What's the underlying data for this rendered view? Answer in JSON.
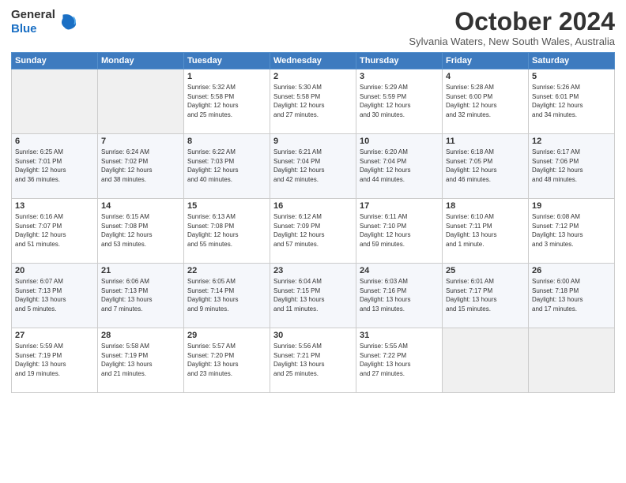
{
  "logo": {
    "general": "General",
    "blue": "Blue"
  },
  "header": {
    "month": "October 2024",
    "location": "Sylvania Waters, New South Wales, Australia"
  },
  "days_of_week": [
    "Sunday",
    "Monday",
    "Tuesday",
    "Wednesday",
    "Thursday",
    "Friday",
    "Saturday"
  ],
  "weeks": [
    [
      {
        "day": "",
        "info": ""
      },
      {
        "day": "",
        "info": ""
      },
      {
        "day": "1",
        "info": "Sunrise: 5:32 AM\nSunset: 5:58 PM\nDaylight: 12 hours\nand 25 minutes."
      },
      {
        "day": "2",
        "info": "Sunrise: 5:30 AM\nSunset: 5:58 PM\nDaylight: 12 hours\nand 27 minutes."
      },
      {
        "day": "3",
        "info": "Sunrise: 5:29 AM\nSunset: 5:59 PM\nDaylight: 12 hours\nand 30 minutes."
      },
      {
        "day": "4",
        "info": "Sunrise: 5:28 AM\nSunset: 6:00 PM\nDaylight: 12 hours\nand 32 minutes."
      },
      {
        "day": "5",
        "info": "Sunrise: 5:26 AM\nSunset: 6:01 PM\nDaylight: 12 hours\nand 34 minutes."
      }
    ],
    [
      {
        "day": "6",
        "info": "Sunrise: 6:25 AM\nSunset: 7:01 PM\nDaylight: 12 hours\nand 36 minutes."
      },
      {
        "day": "7",
        "info": "Sunrise: 6:24 AM\nSunset: 7:02 PM\nDaylight: 12 hours\nand 38 minutes."
      },
      {
        "day": "8",
        "info": "Sunrise: 6:22 AM\nSunset: 7:03 PM\nDaylight: 12 hours\nand 40 minutes."
      },
      {
        "day": "9",
        "info": "Sunrise: 6:21 AM\nSunset: 7:04 PM\nDaylight: 12 hours\nand 42 minutes."
      },
      {
        "day": "10",
        "info": "Sunrise: 6:20 AM\nSunset: 7:04 PM\nDaylight: 12 hours\nand 44 minutes."
      },
      {
        "day": "11",
        "info": "Sunrise: 6:18 AM\nSunset: 7:05 PM\nDaylight: 12 hours\nand 46 minutes."
      },
      {
        "day": "12",
        "info": "Sunrise: 6:17 AM\nSunset: 7:06 PM\nDaylight: 12 hours\nand 48 minutes."
      }
    ],
    [
      {
        "day": "13",
        "info": "Sunrise: 6:16 AM\nSunset: 7:07 PM\nDaylight: 12 hours\nand 51 minutes."
      },
      {
        "day": "14",
        "info": "Sunrise: 6:15 AM\nSunset: 7:08 PM\nDaylight: 12 hours\nand 53 minutes."
      },
      {
        "day": "15",
        "info": "Sunrise: 6:13 AM\nSunset: 7:08 PM\nDaylight: 12 hours\nand 55 minutes."
      },
      {
        "day": "16",
        "info": "Sunrise: 6:12 AM\nSunset: 7:09 PM\nDaylight: 12 hours\nand 57 minutes."
      },
      {
        "day": "17",
        "info": "Sunrise: 6:11 AM\nSunset: 7:10 PM\nDaylight: 12 hours\nand 59 minutes."
      },
      {
        "day": "18",
        "info": "Sunrise: 6:10 AM\nSunset: 7:11 PM\nDaylight: 13 hours\nand 1 minute."
      },
      {
        "day": "19",
        "info": "Sunrise: 6:08 AM\nSunset: 7:12 PM\nDaylight: 13 hours\nand 3 minutes."
      }
    ],
    [
      {
        "day": "20",
        "info": "Sunrise: 6:07 AM\nSunset: 7:13 PM\nDaylight: 13 hours\nand 5 minutes."
      },
      {
        "day": "21",
        "info": "Sunrise: 6:06 AM\nSunset: 7:13 PM\nDaylight: 13 hours\nand 7 minutes."
      },
      {
        "day": "22",
        "info": "Sunrise: 6:05 AM\nSunset: 7:14 PM\nDaylight: 13 hours\nand 9 minutes."
      },
      {
        "day": "23",
        "info": "Sunrise: 6:04 AM\nSunset: 7:15 PM\nDaylight: 13 hours\nand 11 minutes."
      },
      {
        "day": "24",
        "info": "Sunrise: 6:03 AM\nSunset: 7:16 PM\nDaylight: 13 hours\nand 13 minutes."
      },
      {
        "day": "25",
        "info": "Sunrise: 6:01 AM\nSunset: 7:17 PM\nDaylight: 13 hours\nand 15 minutes."
      },
      {
        "day": "26",
        "info": "Sunrise: 6:00 AM\nSunset: 7:18 PM\nDaylight: 13 hours\nand 17 minutes."
      }
    ],
    [
      {
        "day": "27",
        "info": "Sunrise: 5:59 AM\nSunset: 7:19 PM\nDaylight: 13 hours\nand 19 minutes."
      },
      {
        "day": "28",
        "info": "Sunrise: 5:58 AM\nSunset: 7:19 PM\nDaylight: 13 hours\nand 21 minutes."
      },
      {
        "day": "29",
        "info": "Sunrise: 5:57 AM\nSunset: 7:20 PM\nDaylight: 13 hours\nand 23 minutes."
      },
      {
        "day": "30",
        "info": "Sunrise: 5:56 AM\nSunset: 7:21 PM\nDaylight: 13 hours\nand 25 minutes."
      },
      {
        "day": "31",
        "info": "Sunrise: 5:55 AM\nSunset: 7:22 PM\nDaylight: 13 hours\nand 27 minutes."
      },
      {
        "day": "",
        "info": ""
      },
      {
        "day": "",
        "info": ""
      }
    ]
  ]
}
